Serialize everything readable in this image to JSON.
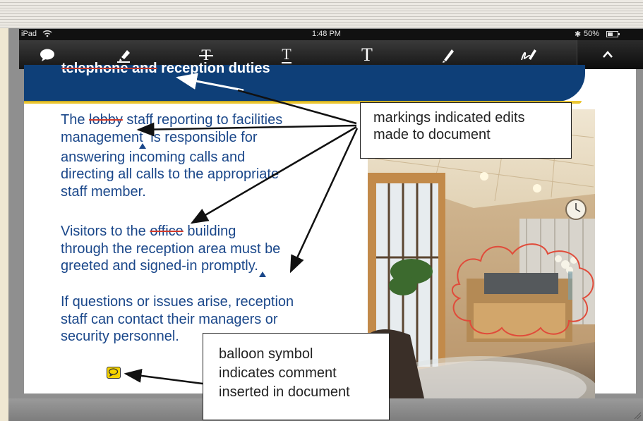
{
  "status_bar": {
    "device": "iPad",
    "time": "1:48 PM",
    "battery": "50%"
  },
  "toolbar": {
    "tools": [
      {
        "name": "comment-icon"
      },
      {
        "name": "highlighter-icon"
      },
      {
        "name": "strikethrough-icon",
        "glyph": "T"
      },
      {
        "name": "underline-icon",
        "glyph": "T"
      },
      {
        "name": "text-insert-icon",
        "glyph": "T"
      },
      {
        "name": "pen-icon"
      },
      {
        "name": "signature-icon"
      }
    ],
    "collapse_icon": "chevron-up-icon"
  },
  "document": {
    "title_struck": "telephone and",
    "title_rest": " reception duties",
    "para1": {
      "before": "The ",
      "struck": "lobby",
      "after": " staff reporting to facilities",
      "line2a": "management",
      "line2b": " is responsible for",
      "line3": "answering incoming calls and",
      "line4": "directing all calls to the appropriate",
      "line5": "staff member."
    },
    "para2": {
      "before": "Visitors to the ",
      "struck": "office",
      "after": " building",
      "line2": "through the reception area must be",
      "line3": "greeted and signed-in promptly."
    },
    "para3": {
      "line1": "If questions or issues arise, reception",
      "line2": "staff can contact their managers or",
      "line3": "security personnel."
    }
  },
  "callouts": {
    "edits_line1": "markings indicated edits",
    "edits_line2": "made to document",
    "balloon_line1": "balloon symbol",
    "balloon_line2": "indicates comment",
    "balloon_line3": "inserted in document"
  },
  "colors": {
    "doc_text": "#1a478a",
    "banner": "#0e3f78",
    "strike": "#d23a2b",
    "comment_icon": "#f5d300"
  }
}
